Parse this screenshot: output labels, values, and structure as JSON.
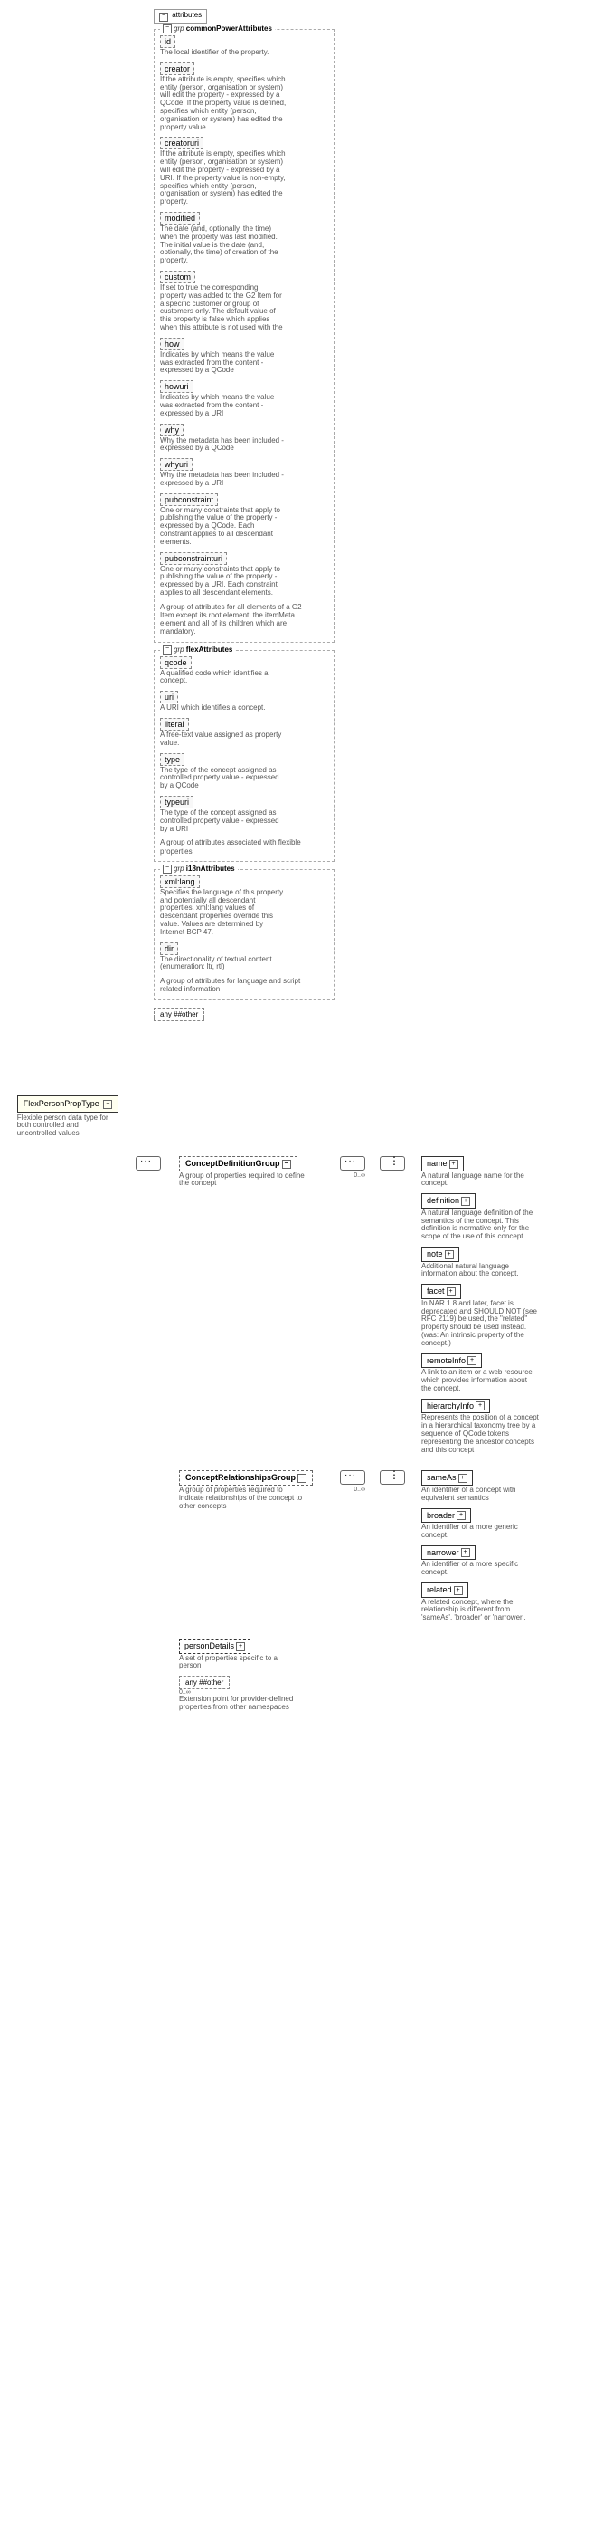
{
  "root": {
    "name": "FlexPersonPropType",
    "desc": "Flexible person data type for both controlled and uncontrolled values"
  },
  "attributes_label": "attributes",
  "groups": [
    {
      "prefix": "grp",
      "name": "commonPowerAttributes",
      "footer": "A group of attributes for all elements of a G2 Item except its root element, the itemMeta element and all of its children which are mandatory.",
      "attrs": [
        {
          "name": "id",
          "desc": "The local identifier of the property."
        },
        {
          "name": "creator",
          "desc": "If the attribute is empty, specifies which entity (person, organisation or system) will edit the property - expressed by a QCode. If the property value is defined, specifies which entity (person, organisation or system) has edited the property value."
        },
        {
          "name": "creatoruri",
          "desc": "If the attribute is empty, specifies which entity (person, organisation or system) will edit the property - expressed by a URI. If the property value is non-empty, specifies which entity (person, organisation or system) has edited the property."
        },
        {
          "name": "modified",
          "desc": "The date (and, optionally, the time) when the property was last modified. The initial value is the date (and, optionally, the time) of creation of the property."
        },
        {
          "name": "custom",
          "desc": "If set to true the corresponding property was added to the G2 Item for a specific customer or group of customers only. The default value of this property is false which applies when this attribute is not used with the"
        },
        {
          "name": "how",
          "desc": "Indicates by which means the value was extracted from the content - expressed by a QCode"
        },
        {
          "name": "howuri",
          "desc": "Indicates by which means the value was extracted from the content - expressed by a URI"
        },
        {
          "name": "why",
          "desc": "Why the metadata has been included - expressed by a QCode"
        },
        {
          "name": "whyuri",
          "desc": "Why the metadata has been included - expressed by a URI"
        },
        {
          "name": "pubconstraint",
          "desc": "One or many constraints that apply to publishing the value of the property - expressed by a QCode. Each constraint applies to all descendant elements."
        },
        {
          "name": "pubconstrainturi",
          "desc": "One or many constraints that apply to publishing the value of the property - expressed by a URI. Each constraint applies to all descendant elements."
        }
      ]
    },
    {
      "prefix": "grp",
      "name": "flexAttributes",
      "footer": "A group of attributes associated with flexible properties",
      "attrs": [
        {
          "name": "qcode",
          "desc": "A qualified code which identifies a concept."
        },
        {
          "name": "uri",
          "desc": "A URI which identifies a concept."
        },
        {
          "name": "literal",
          "desc": "A free-text value assigned as property value."
        },
        {
          "name": "type",
          "desc": "The type of the concept assigned as controlled property value - expressed by a QCode"
        },
        {
          "name": "typeuri",
          "desc": "The type of the concept assigned as controlled property value - expressed by a URI"
        }
      ]
    },
    {
      "prefix": "grp",
      "name": "i18nAttributes",
      "footer": "A group of attributes for language and script related information",
      "attrs": [
        {
          "name": "xml:lang",
          "desc": "Specifies the language of this property and potentially all descendant properties. xml:lang values of descendant properties override this value. Values are determined by Internet BCP 47."
        },
        {
          "name": "dir",
          "desc": "The directionality of textual content (enumeration: ltr, rtl)"
        }
      ]
    }
  ],
  "any_wildcard": "any ##other",
  "content": {
    "groups": [
      {
        "name": "ConceptDefinitionGroup",
        "desc": "A group of properties required to define the concept",
        "occ": "0..∞",
        "children": [
          {
            "name": "name",
            "desc": "A natural language name for the concept.",
            "expand": true
          },
          {
            "name": "definition",
            "desc": "A natural language definition of the semantics of the concept. This definition is normative only for the scope of the use of this concept.",
            "expand": true
          },
          {
            "name": "note",
            "desc": "Additional natural language information about the concept.",
            "expand": true
          },
          {
            "name": "facet",
            "desc": "In NAR 1.8 and later, facet is deprecated and SHOULD NOT (see RFC 2119) be used, the \"related\" property should be used instead. (was: An intrinsic property of the concept.)",
            "expand": true
          },
          {
            "name": "remoteInfo",
            "desc": "A link to an item or a web resource which provides information about the concept.",
            "expand": true
          },
          {
            "name": "hierarchyInfo",
            "desc": "Represents the position of a concept in a hierarchical taxonomy tree by a sequence of QCode tokens representing the ancestor concepts and this concept",
            "expand": true
          }
        ]
      },
      {
        "name": "ConceptRelationshipsGroup",
        "desc": "A group of properties required to indicate relationships of the concept to other concepts",
        "occ": "0..∞",
        "children": [
          {
            "name": "sameAs",
            "desc": "An identifier of a concept with equivalent semantics",
            "expand": true
          },
          {
            "name": "broader",
            "desc": "An identifier of a more generic concept.",
            "expand": true
          },
          {
            "name": "narrower",
            "desc": "An identifier of a more specific concept.",
            "expand": true
          },
          {
            "name": "related",
            "desc": "A related concept, where the relationship is different from 'sameAs', 'broader' or 'narrower'.",
            "expand": true
          }
        ]
      }
    ],
    "elements": [
      {
        "name": "personDetails",
        "dashed": true,
        "desc": "A set of properties specific to a person",
        "expand": true
      }
    ],
    "any": {
      "label": "any ##other",
      "occ": "0..∞",
      "desc": "Extension point for provider-defined properties from other namespaces"
    }
  }
}
